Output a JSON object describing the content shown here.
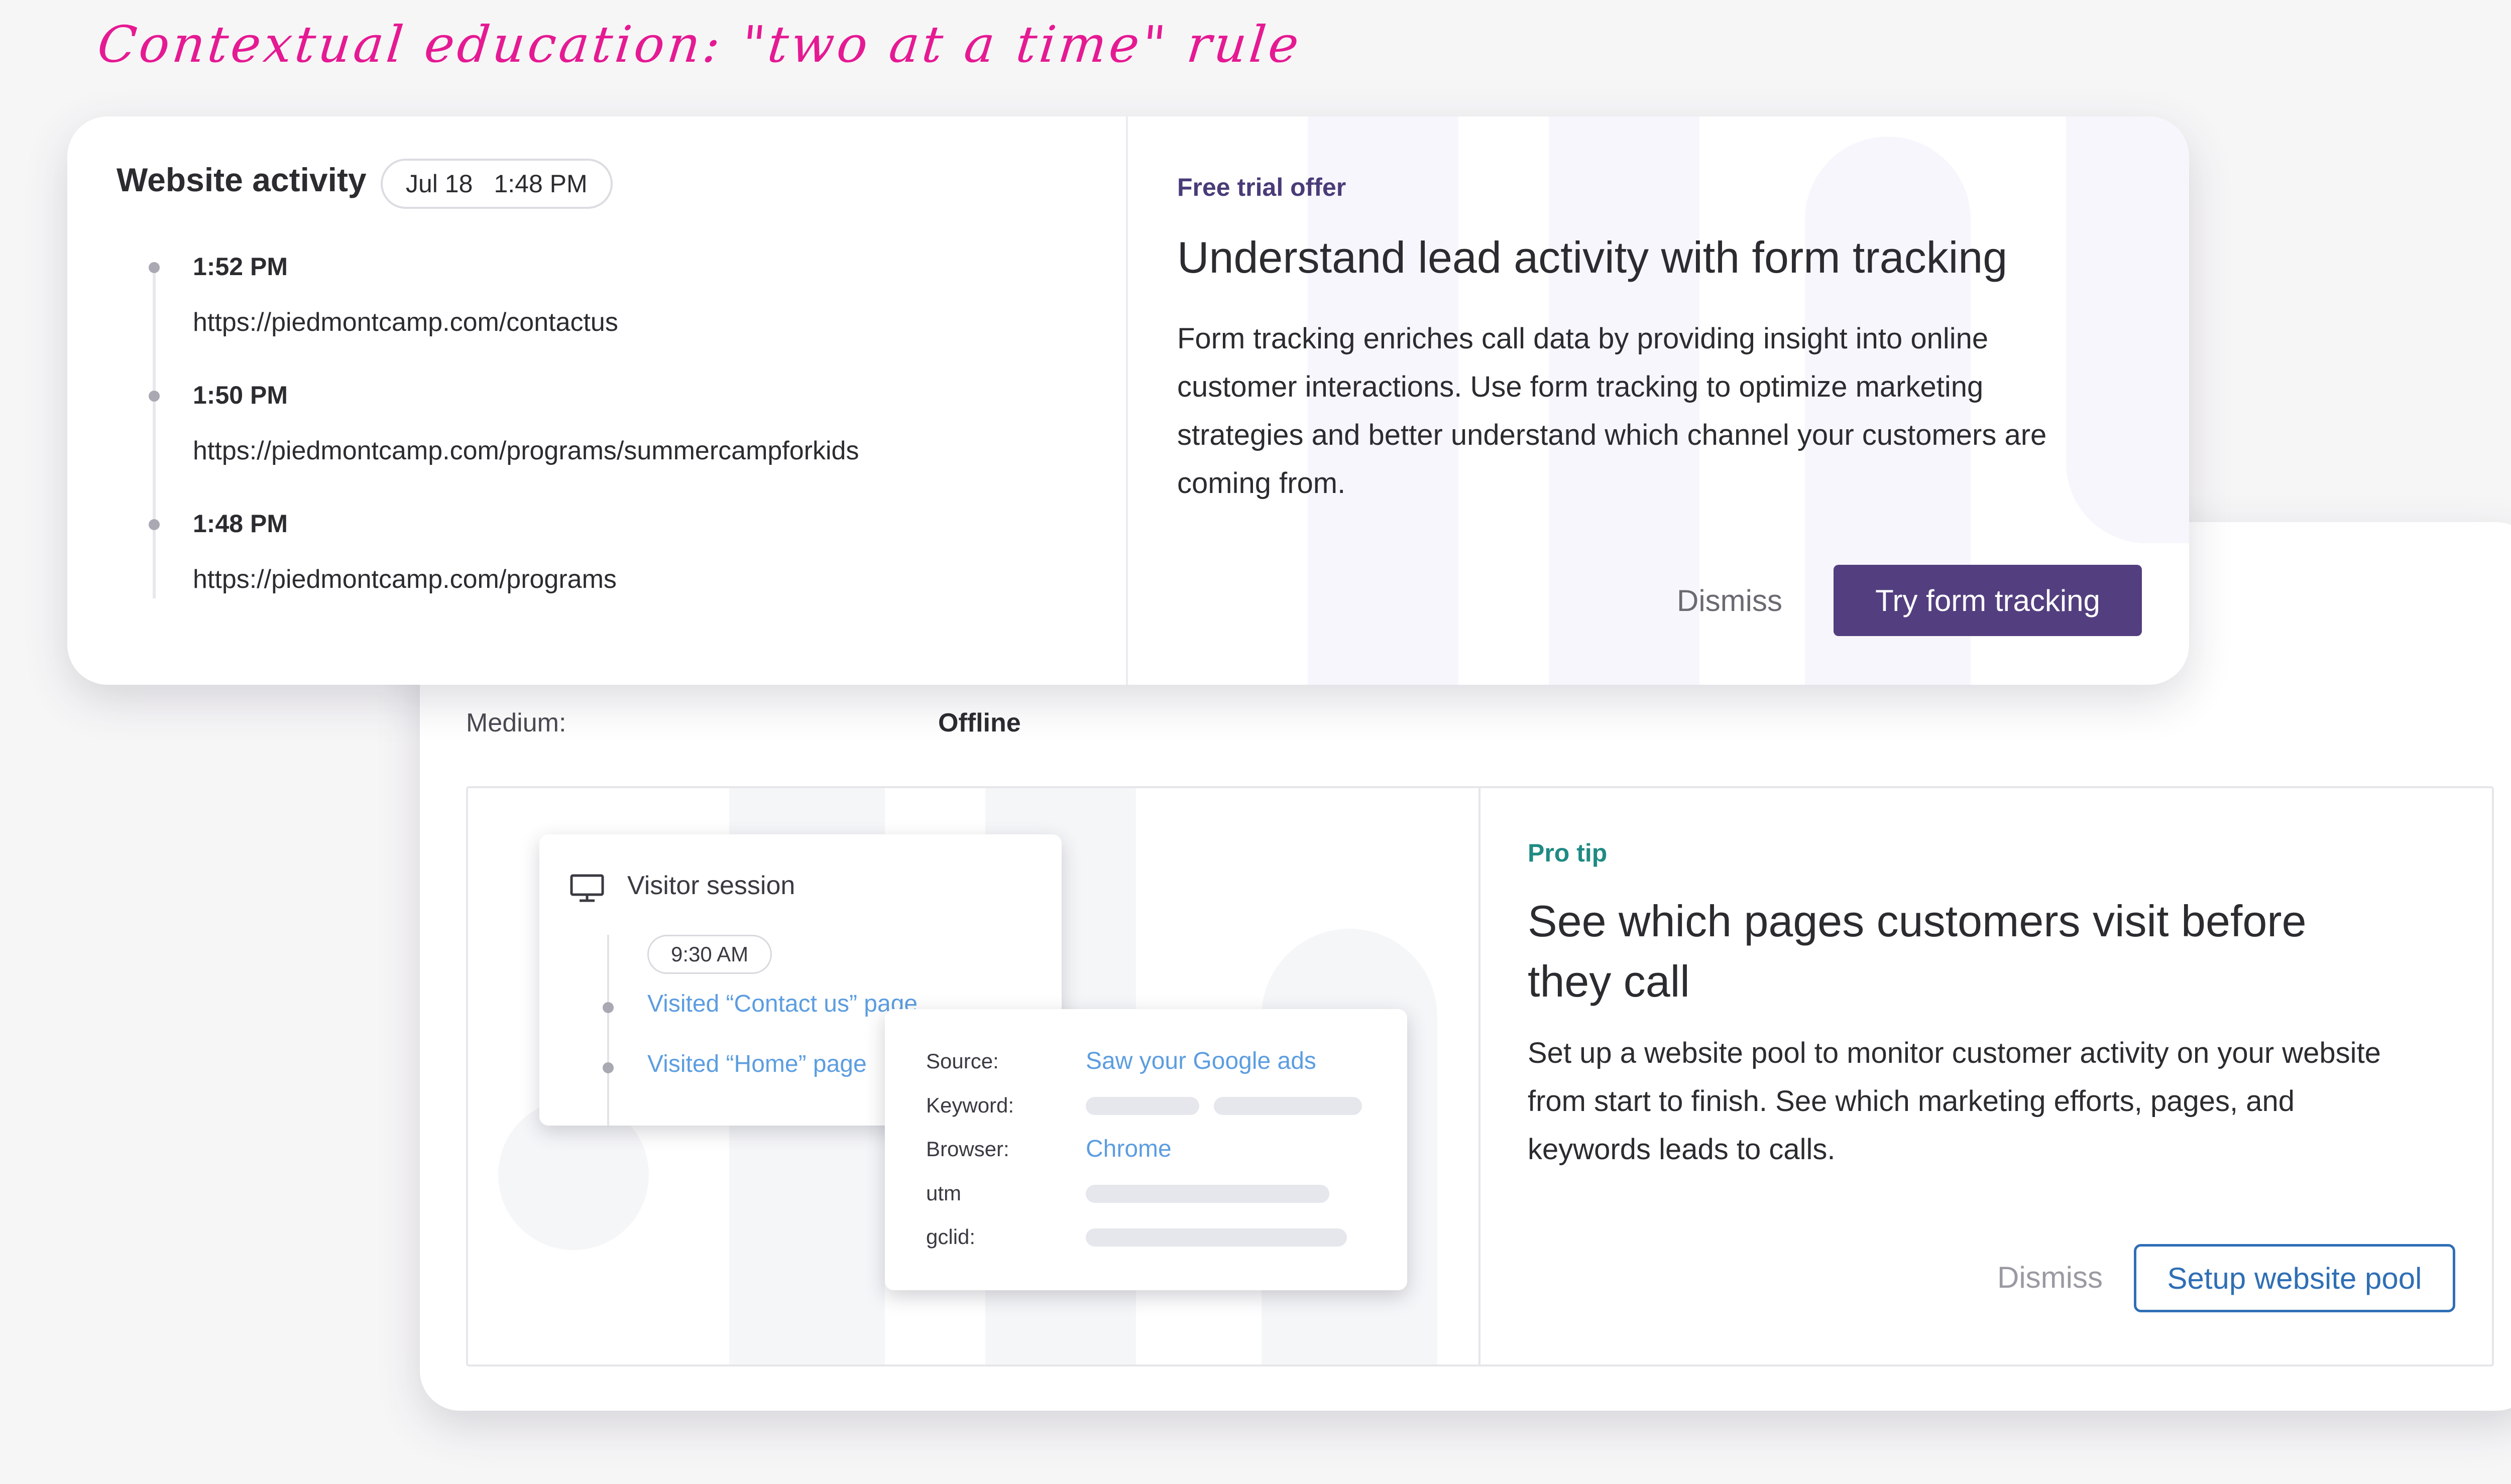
{
  "annotation": "Contextual education: \"two at a time\" rule",
  "website_activity": {
    "title": "Website activity",
    "badge_date": "Jul 18",
    "badge_time": "1:48 PM",
    "events": [
      {
        "time": "1:52 PM",
        "url": "https://piedmontcamp.com/contactus"
      },
      {
        "time": "1:50 PM",
        "url": "https://piedmontcamp.com/programs/summercampforkids"
      },
      {
        "time": "1:48 PM",
        "url": "https://piedmontcamp.com/programs"
      }
    ]
  },
  "free_trial": {
    "kicker": "Free trial offer",
    "title": "Understand lead activity with form tracking",
    "body": "Form tracking enriches call data by providing insight into online customer interactions. Use form tracking to optimize marketing strategies and better understand which channel your customers are coming from.",
    "dismiss_label": "Dismiss",
    "cta_label": "Try form tracking"
  },
  "medium": {
    "label": "Medium:",
    "value": "Offline"
  },
  "visitor_session": {
    "title": "Visitor session",
    "time": "9:30 AM",
    "items": [
      "Visited “Contact us” page",
      "Visited “Home” page"
    ]
  },
  "source_details": {
    "source_label": "Source:",
    "source_value": "Saw your Google ads",
    "keyword_label": "Keyword:",
    "browser_label": "Browser:",
    "browser_value": "Chrome",
    "utm_label": "utm",
    "gclid_label": "gclid:"
  },
  "pro_tip": {
    "kicker": "Pro tip",
    "title": "See which pages customers visit before they call",
    "body": "Set up a website pool to monitor customer activity on your website from start to finish. See which marketing efforts, pages, and keywords leads to calls.",
    "dismiss_label": "Dismiss",
    "cta_label": "Setup website pool"
  },
  "colors": {
    "annotation": "#e51a93",
    "primary_button": "#533f7f",
    "secondary_button_border": "#2f6fb5",
    "link": "#5c9de0",
    "pro_tip_kicker": "#1f8b83"
  }
}
